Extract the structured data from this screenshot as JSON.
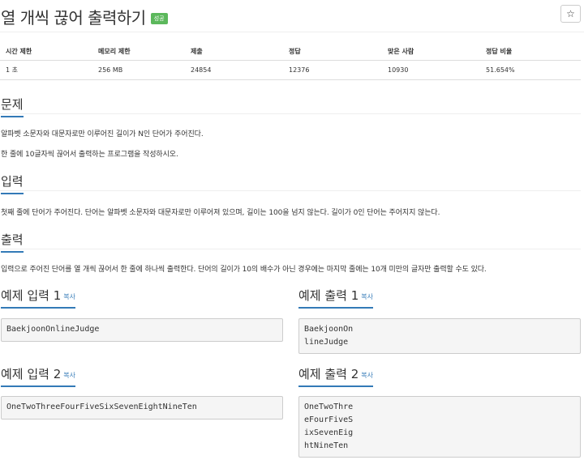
{
  "problem": {
    "title": "열 개씩 끊어 출력하기",
    "badge": "성공",
    "star": "☆"
  },
  "info_table": {
    "headers": [
      "시간 제한",
      "메모리 제한",
      "제출",
      "정답",
      "맞은 사람",
      "정답 비율"
    ],
    "values": [
      "1 초",
      "256 MB",
      "24854",
      "12376",
      "10930",
      "51.654%"
    ]
  },
  "sections": {
    "description": {
      "heading": "문제",
      "paragraphs": [
        "알파벳 소문자와 대문자로만 이루어진 길이가 N인 단어가 주어진다.",
        "한 줄에 10글자씩 끊어서 출력하는 프로그램을 작성하시오."
      ]
    },
    "input": {
      "heading": "입력",
      "text": "첫째 줄에 단어가 주어진다. 단어는 알파벳 소문자와 대문자로만 이루어져 있으며, 길이는 100을 넘지 않는다. 길이가 0인 단어는 주어지지 않는다."
    },
    "output": {
      "heading": "출력",
      "text": "입력으로 주어진 단어를 열 개씩 끊어서 한 줄에 하나씩 출력한다. 단어의 길이가 10의 배수가 아닌 경우에는 마지막 줄에는 10개 미만의 글자만 출력할 수도 있다."
    }
  },
  "copy_label": "복사",
  "samples": [
    {
      "input_heading": "예제 입력 1",
      "input": "BaekjoonOnlineJudge",
      "output_heading": "예제 출력 1",
      "output": "BaekjoonOn\nlineJudge"
    },
    {
      "input_heading": "예제 입력 2",
      "input": "OneTwoThreeFourFiveSixSevenEightNineTen",
      "output_heading": "예제 출력 2",
      "output": "OneTwoThre\neFourFiveS\nixSevenEig\nhtNineTen"
    }
  ]
}
